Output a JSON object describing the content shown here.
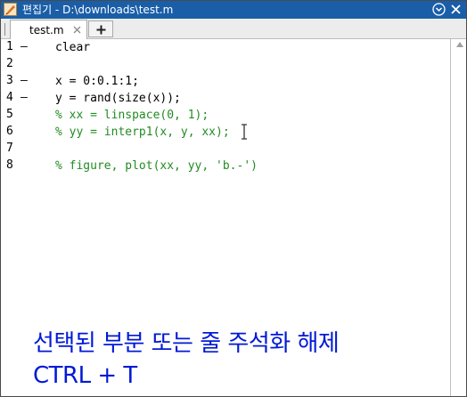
{
  "window": {
    "title": "편집기 - D:\\downloads\\test.m",
    "menu_icon": "circle-chevron-down-icon",
    "close_icon": "close-icon",
    "app_icon": "editor-icon"
  },
  "tabs": {
    "active_label": "test.m",
    "close_icon": "close-icon",
    "add_icon": "plus-icon"
  },
  "editor": {
    "lines": [
      {
        "number": "1",
        "breakpoint": "–",
        "code": "clear",
        "comment": false
      },
      {
        "number": "2",
        "breakpoint": "",
        "code": "",
        "comment": false
      },
      {
        "number": "3",
        "breakpoint": "–",
        "code": "x = 0:0.1:1;",
        "comment": false
      },
      {
        "number": "4",
        "breakpoint": "–",
        "code": "y = rand(size(x));",
        "comment": false
      },
      {
        "number": "5",
        "breakpoint": "",
        "code": "% xx = linspace(0, 1);",
        "comment": true
      },
      {
        "number": "6",
        "breakpoint": "",
        "code": "% yy = interp1(x, y, xx);",
        "comment": true
      },
      {
        "number": "7",
        "breakpoint": "",
        "code": "",
        "comment": false
      },
      {
        "number": "8",
        "breakpoint": "",
        "code": "% figure, plot(xx, yy, 'b.-')",
        "comment": true
      }
    ]
  },
  "caption": {
    "line1": "선택된 부분 또는 줄 주석화 해제",
    "line2": "CTRL + T",
    "color": "#0019d6"
  },
  "colors": {
    "titlebar": "#1a5ea8",
    "comment": "#228B22"
  }
}
